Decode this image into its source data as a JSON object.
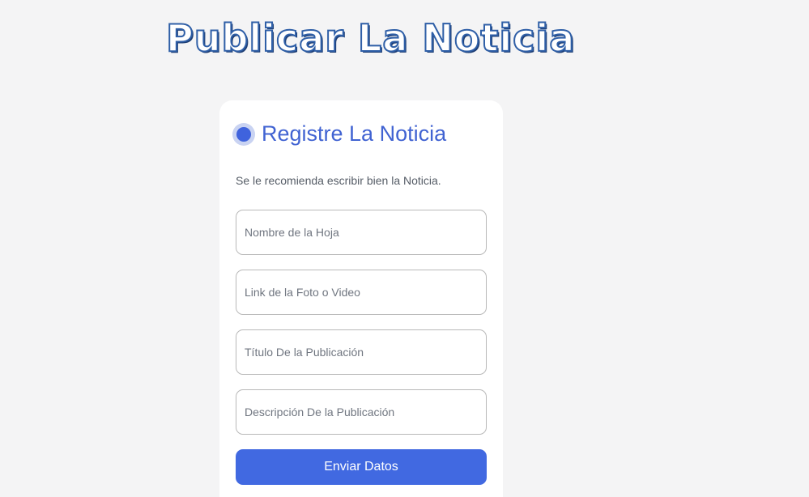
{
  "page": {
    "title": "Publicar La Noticia"
  },
  "card": {
    "title": "Registre La Noticia",
    "hint": "Se le recomienda escribir bien la Noticia.",
    "fields": [
      {
        "placeholder": "Nombre de la Hoja",
        "value": ""
      },
      {
        "placeholder": "Link de la Foto o Video",
        "value": ""
      },
      {
        "placeholder": "Título De la Publicación",
        "value": ""
      },
      {
        "placeholder": "Descripción De la Publicación",
        "value": ""
      }
    ],
    "submit_label": "Enviar Datos"
  },
  "colors": {
    "background": "#f4f4f5",
    "accent": "#4169e1",
    "title_blue": "#4163d2",
    "headline_outline": "#2f5fa7"
  },
  "icons": {
    "header_marker": "radio-dot-icon"
  }
}
